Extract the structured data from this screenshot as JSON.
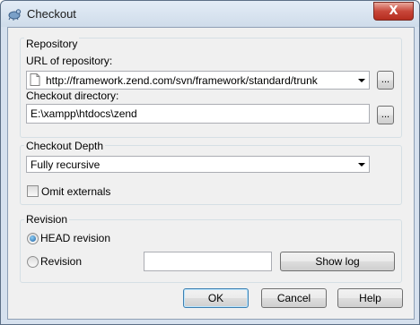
{
  "window": {
    "title": "Checkout",
    "close_glyph": "X",
    "icon": "tortoisesvn-icon"
  },
  "repository": {
    "group_label": "Repository",
    "url_label": "URL of repository:",
    "url_value": "http://framework.zend.com/svn/framework/standard/trunk",
    "url_browse_label": "...",
    "dir_label": "Checkout directory:",
    "dir_value": "E:\\xampp\\htdocs\\zend",
    "dir_browse_label": "..."
  },
  "depth": {
    "group_label": "Checkout Depth",
    "selected": "Fully recursive",
    "omit_externals_label": "Omit externals",
    "omit_externals_checked": false
  },
  "revision": {
    "group_label": "Revision",
    "head_label": "HEAD revision",
    "head_selected": true,
    "revision_label": "Revision",
    "revision_value": "",
    "show_log_label": "Show log"
  },
  "buttons": {
    "ok": "OK",
    "cancel": "Cancel",
    "help": "Help"
  }
}
